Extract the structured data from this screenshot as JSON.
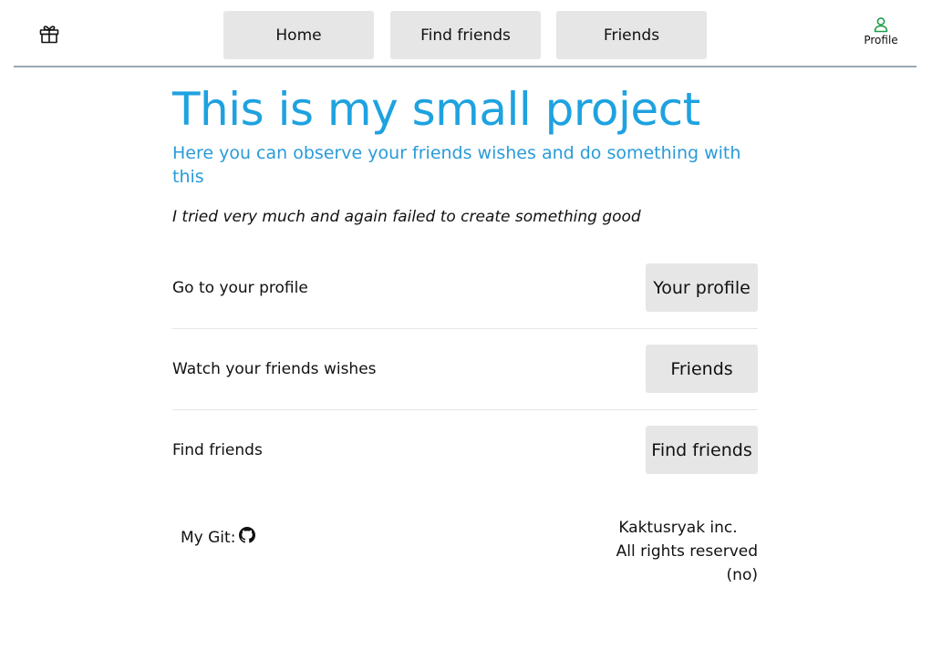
{
  "nav": {
    "gift_icon": "gift-icon",
    "buttons": [
      {
        "label": "Home"
      },
      {
        "label": "Find friends"
      },
      {
        "label": "Friends"
      }
    ],
    "profile": {
      "label": "Profile",
      "icon": "user-icon",
      "color": "#1e9e4a"
    }
  },
  "hero": {
    "title": "This is my small project",
    "subtitle": "Here you can observe your friends wishes and do something with this",
    "note": "I tried very much and again failed to create something good",
    "title_color": "#1ea2e0"
  },
  "actions": [
    {
      "text": "Go to your profile",
      "button": "Your profile"
    },
    {
      "text": "Watch your friends wishes",
      "button": "Friends"
    },
    {
      "text": "Find friends",
      "button": "Find friends"
    }
  ],
  "footer": {
    "git_label": "My Git:",
    "git_icon": "github-icon",
    "company": "Kaktusryak inc.",
    "rights": "All rights reserved (no)"
  }
}
